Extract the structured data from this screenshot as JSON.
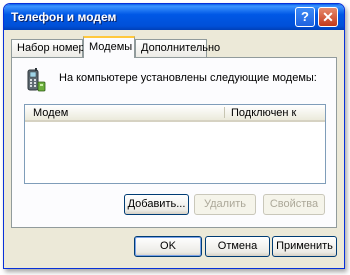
{
  "window": {
    "title": "Телефон и модем"
  },
  "titlebar": {
    "help_glyph": "?",
    "close_glyph": "✕"
  },
  "tabs": [
    {
      "label": "Набор номера",
      "active": false
    },
    {
      "label": "Модемы",
      "active": true
    },
    {
      "label": "Дополнительно",
      "active": false
    }
  ],
  "modems_tab": {
    "icon": "phone-modem-icon",
    "description": "На компьютере установлены следующие модемы:",
    "columns": [
      "Модем",
      "Подключен к"
    ],
    "rows": [],
    "buttons": {
      "add": "Добавить...",
      "remove": "Удалить",
      "properties": "Свойства"
    }
  },
  "footer": {
    "ok": "OK",
    "cancel": "Отмена",
    "apply": "Применить"
  },
  "colors": {
    "titlebar": "#0058E6",
    "dialog_bg": "#ECE9D8",
    "active_tab_accent": "#FFC83C"
  }
}
